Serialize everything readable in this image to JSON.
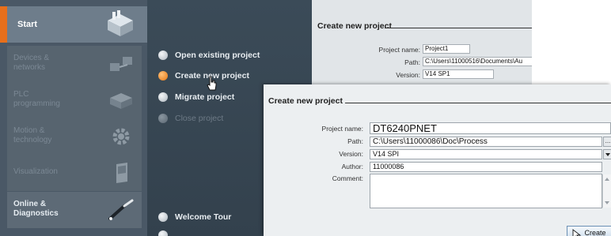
{
  "nav": {
    "start": "Start",
    "items": [
      {
        "label": "Devices &\nnetworks",
        "enabled": false,
        "icon": "network-icon"
      },
      {
        "label": "PLC\nprogramming",
        "enabled": false,
        "icon": "plc-icon"
      },
      {
        "label": "Motion &\ntechnology",
        "enabled": false,
        "icon": "gear-icon"
      },
      {
        "label": "Visualization",
        "enabled": false,
        "icon": "panel-icon"
      },
      {
        "label": "Online &\nDiagnostics",
        "enabled": true,
        "icon": "probe-icon"
      }
    ]
  },
  "actions": {
    "open": "Open existing project",
    "create": "Create new project",
    "migrate": "Migrate project",
    "close": "Close project",
    "tour": "Welcome Tour"
  },
  "back_dialog": {
    "title": "Create new project",
    "name_label": "Project name:",
    "name_value": "Project1",
    "path_label": "Path:",
    "path_value": "C:\\Users\\11000516\\Documents\\Au",
    "version_label": "Version:",
    "version_value": "V14 SP1"
  },
  "dialog": {
    "title": "Create new project",
    "name_label": "Project name:",
    "name_value": "DT6240PNET",
    "path_label": "Path:",
    "path_value": "C:\\Users\\11000086\\Doc\\Process",
    "browse": "...",
    "version_label": "Version:",
    "version_value": "V14 SPI",
    "author_label": "Author:",
    "author_value": "11000086",
    "comment_label": "Comment:",
    "comment_value": "",
    "create_button": "Create"
  },
  "colors": {
    "accent": "#e86f1b",
    "nav_bg": "#4a5866",
    "panel_bg": "#3b4b58",
    "dialog_bg": "#eceff1"
  }
}
